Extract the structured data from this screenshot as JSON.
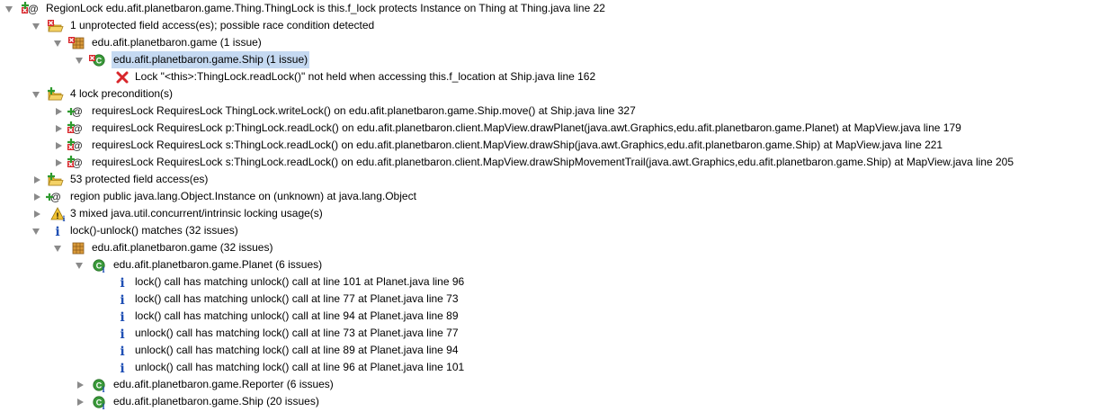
{
  "tree": {
    "root_label": "RegionLock edu.afit.planetbaron.game.Thing.ThingLock is this.f_lock protects Instance  on  Thing  at  Thing.java line 22",
    "unprotected": {
      "label": "1 unprotected field access(es); possible race condition detected",
      "package_label": "edu.afit.planetbaron.game (1 issue)",
      "class_label": "edu.afit.planetbaron.game.Ship (1 issue)",
      "error_label": "Lock \"<this>:ThingLock.readLock()\" not held when accessing this.f_location  at  Ship.java line 162"
    },
    "preconditions": {
      "label": "4 lock precondition(s)",
      "items": [
        "requiresLock RequiresLock ThingLock.writeLock()  on  edu.afit.planetbaron.game.Ship.move()  at  Ship.java line 327",
        "requiresLock RequiresLock p:ThingLock.readLock()  on  edu.afit.planetbaron.client.MapView.drawPlanet(java.awt.Graphics,edu.afit.planetbaron.game.Planet)  at  MapView.java line 179",
        "requiresLock RequiresLock s:ThingLock.readLock()  on  edu.afit.planetbaron.client.MapView.drawShip(java.awt.Graphics,edu.afit.planetbaron.game.Ship)  at  MapView.java line 221",
        "requiresLock RequiresLock s:ThingLock.readLock()  on  edu.afit.planetbaron.client.MapView.drawShipMovementTrail(java.awt.Graphics,edu.afit.planetbaron.game.Ship)  at  MapView.java line 205"
      ]
    },
    "protected_label": "53 protected field access(es)",
    "region_label": "region  public  java.lang.Object.Instance on (unknown)  at  java.lang.Object",
    "mixed_label": "3 mixed java.util.concurrent/intrinsic locking usage(s)",
    "matches": {
      "label": "lock()-unlock() matches (32 issues)",
      "package_label": "edu.afit.planetbaron.game (32 issues)",
      "planet_label": "edu.afit.planetbaron.game.Planet (6 issues)",
      "planet_items": [
        "lock() call has matching unlock() call at line 101  at  Planet.java line 96",
        "lock() call has matching unlock() call at line 77  at  Planet.java line 73",
        "lock() call has matching unlock() call at line 94  at  Planet.java line 89",
        "unlock() call has matching lock() call at line 73  at  Planet.java line 77",
        "unlock() call has matching lock() call at line 89  at  Planet.java line 94",
        "unlock() call has matching lock() call at line 96  at  Planet.java line 101"
      ],
      "reporter_label": "edu.afit.planetbaron.game.Reporter (6 issues)",
      "ship_label": "edu.afit.planetbaron.game.Ship (20 issues)"
    }
  },
  "colors": {
    "selection": "#c5d9f1",
    "info_blue": "#1f4fb4",
    "error_red": "#d8262b",
    "folder_yellow": "#e8b82e",
    "class_green": "#3a9a3a"
  }
}
